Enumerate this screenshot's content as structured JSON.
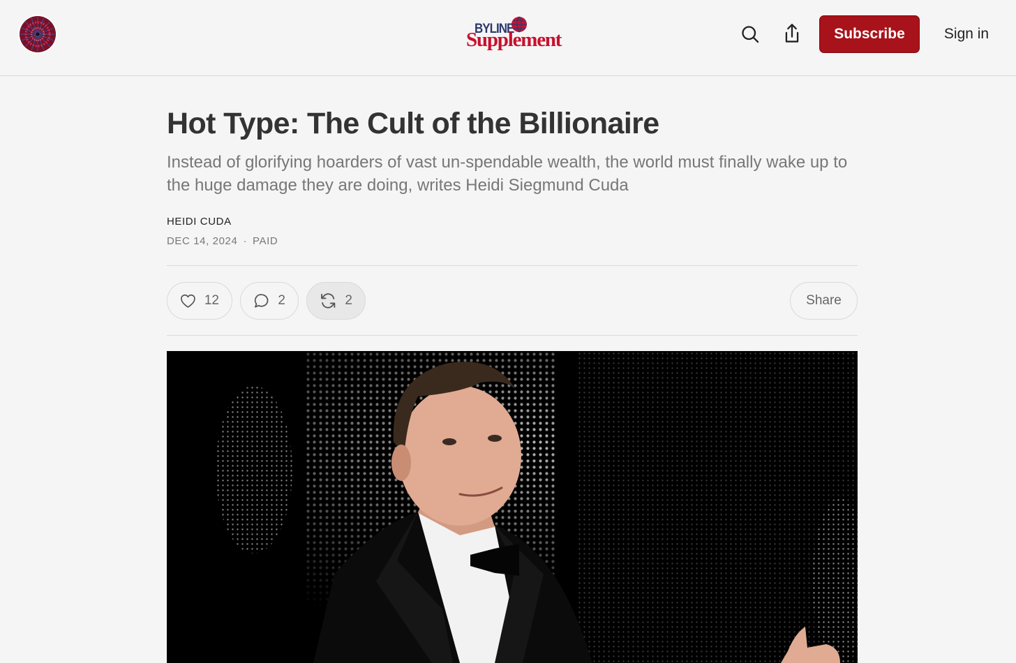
{
  "header": {
    "brand_top": "BYLINE",
    "brand_main": "Supplement",
    "subscribe_label": "Subscribe",
    "signin_label": "Sign in",
    "accent_color": "#a8121a"
  },
  "article": {
    "title": "Hot Type: The Cult of the Billionaire",
    "subtitle": "Instead of glorifying hoarders of vast un-spendable wealth, the world must finally wake up to the huge damage they are doing, writes Heidi Siegmund Cuda",
    "author": "HEIDI CUDA",
    "date": "DEC 14, 2024",
    "separator": "·",
    "access": "PAID"
  },
  "actions": {
    "likes": "12",
    "comments": "2",
    "restacks": "2",
    "share_label": "Share"
  },
  "icons": {
    "site_logo": "site-logo-icon",
    "search": "search-icon",
    "share": "share-icon",
    "like": "heart-icon",
    "comment": "comment-icon",
    "restack": "restack-icon"
  }
}
